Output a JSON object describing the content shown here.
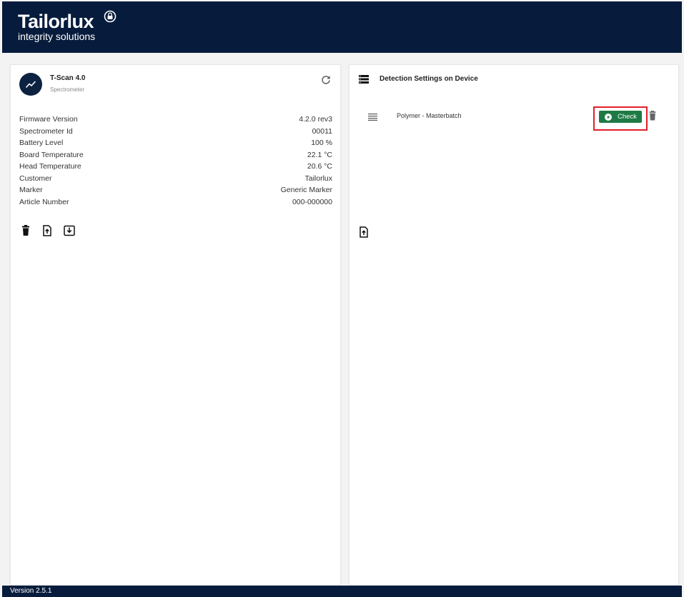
{
  "brand": {
    "name": "Tailorlux",
    "tagline": "integrity solutions",
    "primary_color": "#071c3c"
  },
  "device": {
    "name": "T-Scan 4.0",
    "type": "Spectrometer",
    "avatar_icon": "trend-line-icon",
    "refresh_icon": "refresh-icon"
  },
  "device_info": [
    {
      "label": "Firmware Version",
      "value": "4.2.0 rev3"
    },
    {
      "label": "Spectrometer Id",
      "value": "00011"
    },
    {
      "label": "Battery Level",
      "value": "100 %"
    },
    {
      "label": "Board Temperature",
      "value": "22.1 °C"
    },
    {
      "label": "Head Temperature",
      "value": "20.6 °C"
    },
    {
      "label": "Customer",
      "value": "Tailorlux"
    },
    {
      "label": "Marker",
      "value": "Generic Marker"
    },
    {
      "label": "Article Number",
      "value": "000-000000"
    }
  ],
  "device_actions": [
    "trash-icon",
    "file-upload-icon",
    "download-icon"
  ],
  "detection_settings": {
    "title": "Detection Settings on Device",
    "items": [
      {
        "name": "Polymer - Masterbatch",
        "check_label": "Check"
      }
    ],
    "action_color": "#1e7a45",
    "highlight_color": "#e0202a"
  },
  "footer": {
    "version": "Version 2.5.1"
  }
}
